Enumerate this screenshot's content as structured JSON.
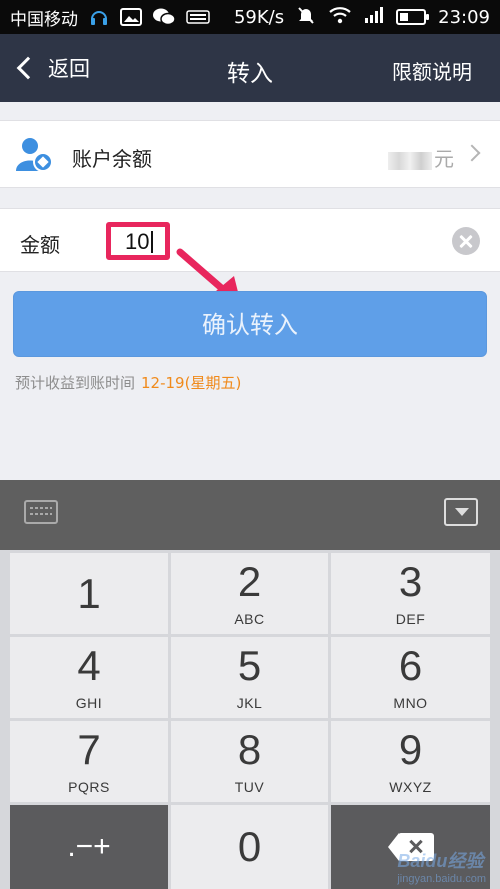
{
  "status_bar": {
    "carrier": "中国移动",
    "net_speed": "59K/s",
    "time": "23:09"
  },
  "nav": {
    "back_label": "返回",
    "title": "转入",
    "right_label": "限额说明"
  },
  "account": {
    "label": "账户余额",
    "unit": "元"
  },
  "amount": {
    "label": "金额",
    "value": "10"
  },
  "confirm_button": "确认转入",
  "hint": {
    "text": "预计收益到账时间",
    "date": "12-19(星期五)"
  },
  "keypad": {
    "keys": [
      {
        "num": "1",
        "letters": ""
      },
      {
        "num": "2",
        "letters": "ABC"
      },
      {
        "num": "3",
        "letters": "DEF"
      },
      {
        "num": "4",
        "letters": "GHI"
      },
      {
        "num": "5",
        "letters": "JKL"
      },
      {
        "num": "6",
        "letters": "MNO"
      },
      {
        "num": "7",
        "letters": "PQRS"
      },
      {
        "num": "8",
        "letters": "TUV"
      },
      {
        "num": "9",
        "letters": "WXYZ"
      }
    ],
    "symbol_key": ".−+",
    "zero_key": "0"
  },
  "watermark": {
    "main": "Baidu经验",
    "sub": "jingyan.baidu.com"
  },
  "colors": {
    "navbar": "#2e3546",
    "confirm_button": "#5f9fe8",
    "highlight_box": "#e8265d",
    "hint_date": "#f08a1b"
  }
}
